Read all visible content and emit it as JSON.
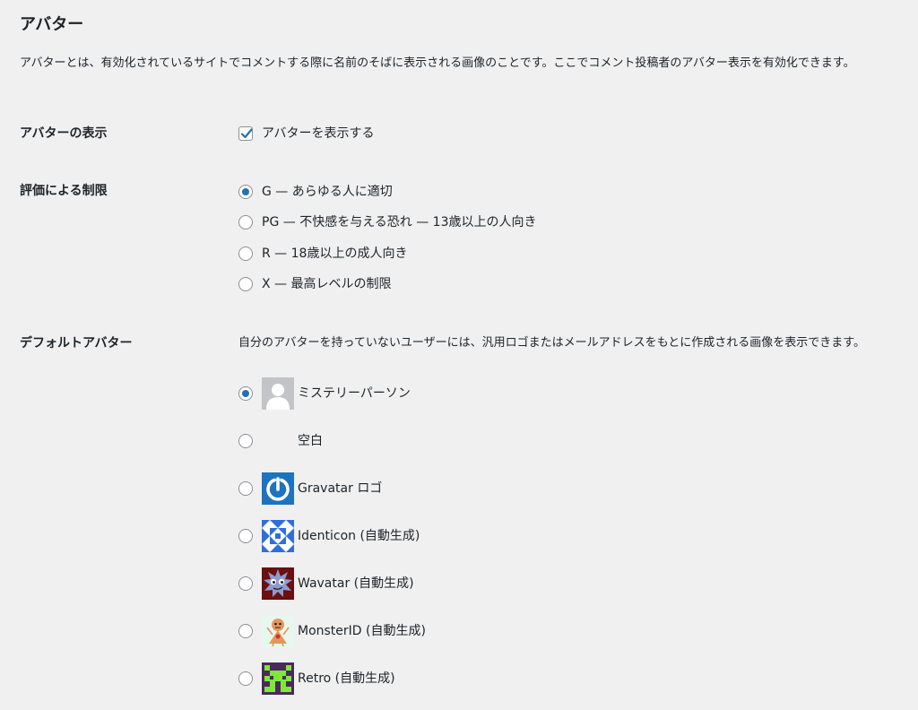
{
  "section": {
    "title": "アバター",
    "description": "アバターとは、有効化されているサイトでコメントする際に名前のそばに表示される画像のことです。ここでコメント投稿者のアバター表示を有効化できます。"
  },
  "show_avatars": {
    "label": "アバターの表示",
    "checkbox_label": "アバターを表示する",
    "checked": true
  },
  "rating": {
    "label": "評価による制限",
    "options": [
      {
        "label": "G — あらゆる人に適切",
        "selected": true
      },
      {
        "label": "PG — 不快感を与える恐れ — 13歳以上の人向き",
        "selected": false
      },
      {
        "label": "R — 18歳以上の成人向き",
        "selected": false
      },
      {
        "label": "X — 最高レベルの制限",
        "selected": false
      }
    ]
  },
  "default_avatar": {
    "label": "デフォルトアバター",
    "description": "自分のアバターを持っていないユーザーには、汎用ロゴまたはメールアドレスをもとに作成される画像を表示できます。",
    "options": [
      {
        "label": "ミステリーパーソン",
        "icon": "mystery-person-icon",
        "selected": true
      },
      {
        "label": "空白",
        "icon": "blank-icon",
        "selected": false
      },
      {
        "label": "Gravatar ロゴ",
        "icon": "gravatar-logo-icon",
        "selected": false
      },
      {
        "label": "Identicon (自動生成)",
        "icon": "identicon-icon",
        "selected": false
      },
      {
        "label": "Wavatar (自動生成)",
        "icon": "wavatar-icon",
        "selected": false
      },
      {
        "label": "MonsterID (自動生成)",
        "icon": "monsterid-icon",
        "selected": false
      },
      {
        "label": "Retro (自動生成)",
        "icon": "retro-icon",
        "selected": false
      }
    ]
  },
  "colors": {
    "background": "#f0f0f1",
    "accent": "#2271b1",
    "text": "#1d2327"
  }
}
